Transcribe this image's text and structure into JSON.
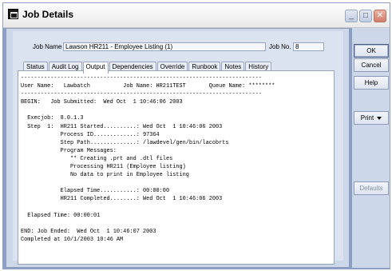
{
  "window": {
    "title": "Job Details",
    "controls": {
      "minimize": "_",
      "maximize": "□",
      "close": "✕"
    }
  },
  "job": {
    "name_label": "Job Name",
    "name_value": "Lawson HR211 - Employee Listing (1)",
    "no_label": "Job No.",
    "no_value": "8"
  },
  "tabs": [
    {
      "label": "Status"
    },
    {
      "label": "Audit Log"
    },
    {
      "label": "Output"
    },
    {
      "label": "Dependencies"
    },
    {
      "label": "Override"
    },
    {
      "label": "Runbook"
    },
    {
      "label": "Notes"
    },
    {
      "label": "History"
    }
  ],
  "active_tab": "Output",
  "output_lines": [
    "-------------------------------------------------------------------------",
    "User Name:   Lawbatch          Job Name: HR211TEST       Queue Name: ********",
    "-------------------------------------------------------------------------",
    "BEGIN:   Job Submitted:  Wed Oct  1 10:46:06 2003",
    "",
    "  Execjob:  8.0.1.3",
    "  Step  1:  HR211 Started..........: Wed Oct  1 10:46:06 2003",
    "            Process ID.............: 97364",
    "            Step Path..............: /lawdevel/gen/bin/lacobrts",
    "            Program Messages:",
    "               ** Creating .prt and .dtl files",
    "               Processing HR211 (Employee listing)",
    "               No data to print in Employee listing",
    "",
    "            Elapsed Time...........: 00:00:00",
    "            HR211 Completed........: Wed Oct  1 10:46:06 2003",
    "",
    "  Elapsed Time: 00:00:01",
    "",
    "END: Job Ended:  Wed Oct  1 10:46:07 2003",
    "Completed at 10/1/2003 10:46 AM"
  ],
  "buttons": {
    "ok": "OK",
    "cancel": "Cancel",
    "help": "Help",
    "print": "Print",
    "defaults": "Defaults"
  }
}
